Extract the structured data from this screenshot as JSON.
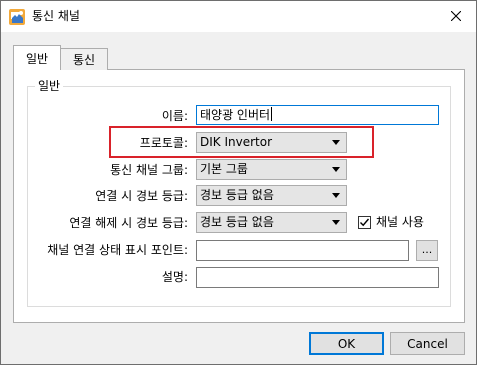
{
  "window": {
    "title": "통신 채널"
  },
  "tabs": [
    {
      "label": "일반"
    },
    {
      "label": "통신"
    }
  ],
  "group": {
    "title": "일반"
  },
  "fields": {
    "name": {
      "label": "이름:",
      "value": "태양광 인버터"
    },
    "protocol": {
      "label": "프로토콜:",
      "value": "DIK Invertor"
    },
    "channel_group": {
      "label": "통신 채널 그룹:",
      "value": "기본 그룹"
    },
    "connect_alarm": {
      "label": "연결 시 경보 등급:",
      "value": "경보 등급 없음"
    },
    "disconnect_alarm": {
      "label": "연결 해제 시 경보 등급:",
      "value": "경보 등급 없음"
    },
    "status_point": {
      "label": "채널 연결 상태 표시 포인트:",
      "value": "",
      "browse_label": "..."
    },
    "description": {
      "label": "설명:",
      "value": ""
    }
  },
  "channel_enabled": {
    "label": "채널 사용",
    "checked": true
  },
  "buttons": {
    "ok": "OK",
    "cancel": "Cancel"
  },
  "colors": {
    "highlight": "#d9222a",
    "focus": "#0078d7"
  },
  "icons": {
    "app": "channel-app-icon",
    "close": "close-icon"
  }
}
